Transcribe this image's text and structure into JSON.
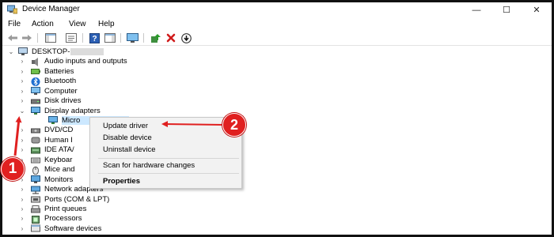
{
  "window": {
    "title": "Device Manager",
    "controls": {
      "minimize": "—",
      "maximize": "☐",
      "close": "✕"
    }
  },
  "menu": [
    "File",
    "Action",
    "View",
    "Help"
  ],
  "toolbar": {
    "icons": [
      "back-arrow-icon",
      "forward-arrow-icon",
      "show-hide-console-tree-icon",
      "properties-icon",
      "help-icon",
      "action-pane-icon",
      "monitor-scan-icon",
      "update-driver-icon",
      "uninstall-device-icon",
      "download-icon"
    ]
  },
  "tree": {
    "root": "DESKTOP-",
    "items": [
      {
        "label": "Audio inputs and outputs",
        "icon": "speaker-icon",
        "expander": "›"
      },
      {
        "label": "Batteries",
        "icon": "battery-icon",
        "expander": "›"
      },
      {
        "label": "Bluetooth",
        "icon": "bluetooth-icon",
        "expander": "›"
      },
      {
        "label": "Computer",
        "icon": "computer-icon",
        "expander": "›"
      },
      {
        "label": "Disk drives",
        "icon": "disk-drive-icon",
        "expander": "›"
      },
      {
        "label": "Display adapters",
        "icon": "display-adapter-icon",
        "expander": "⌄"
      },
      {
        "label": "Micro",
        "icon": "display-adapter-icon",
        "expander": "",
        "selected": true
      },
      {
        "label": "DVD/CD",
        "icon": "dvd-drive-icon",
        "expander": "›"
      },
      {
        "label": "Human I",
        "icon": "human-interface-icon",
        "expander": "›"
      },
      {
        "label": "IDE ATA/",
        "icon": "ide-controller-icon",
        "expander": "›"
      },
      {
        "label": "Keyboar",
        "icon": "keyboard-icon",
        "expander": "›"
      },
      {
        "label": "Mice and",
        "icon": "mouse-icon",
        "expander": "›"
      },
      {
        "label": "Monitors",
        "icon": "monitor-icon",
        "expander": "›"
      },
      {
        "label": "Network adapters",
        "icon": "network-adapter-icon",
        "expander": "›"
      },
      {
        "label": "Ports (COM & LPT)",
        "icon": "port-icon",
        "expander": "›"
      },
      {
        "label": "Print queues",
        "icon": "printer-icon",
        "expander": "›"
      },
      {
        "label": "Processors",
        "icon": "processor-icon",
        "expander": "›"
      },
      {
        "label": "Software devices",
        "icon": "software-device-icon",
        "expander": "›"
      }
    ]
  },
  "context_menu": {
    "items": [
      "Update driver",
      "Disable device",
      "Uninstall device",
      "Scan for hardware changes",
      "Properties"
    ]
  },
  "callouts": {
    "first": "1",
    "second": "2"
  },
  "colors": {
    "annotation_red": "#e02020",
    "selection": "#cce8ff"
  }
}
